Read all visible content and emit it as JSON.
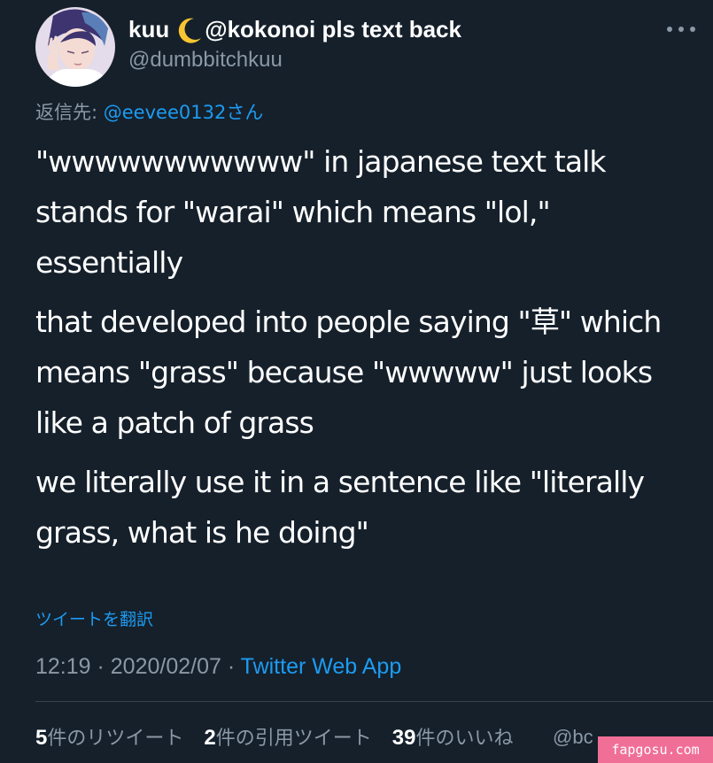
{
  "author": {
    "name_prefix": "kuu",
    "moon_icon": "crescent-moon-emoji",
    "name_suffix": "@kokonoi pls text back",
    "handle": "@dumbbitchkuu"
  },
  "reply": {
    "label": "返信先: ",
    "mention": "@eevee0132",
    "honorific": "さん"
  },
  "tweet": {
    "paragraphs": [
      "\"wwwwwwwwwww\" in japanese text talk stands for \"warai\" which means \"lol,\" essentially",
      "that developed into people saying \"草\" which means \"grass\" because \"wwwww\" just looks like a patch of grass",
      "we literally use it in a sentence like \"literally grass, what is he doing\""
    ],
    "translate_label": "ツイートを翻訳"
  },
  "meta": {
    "time": "12:19",
    "separator": " · ",
    "date": "2020/02/07",
    "source": "Twitter Web App"
  },
  "stats": {
    "retweets_count": "5",
    "retweets_label": "件のリツイート",
    "quotes_count": "2",
    "quotes_label": "件の引用ツイート",
    "likes_count": "39",
    "likes_label": "件のいいね"
  },
  "watermark": {
    "partial_text": "@bc",
    "badge_text": "fapgosu.com"
  },
  "colors": {
    "background": "#15202b",
    "secondary_text": "#8b98a5",
    "accent": "#1d9bf0",
    "watermark_badge": "#f06f96"
  }
}
